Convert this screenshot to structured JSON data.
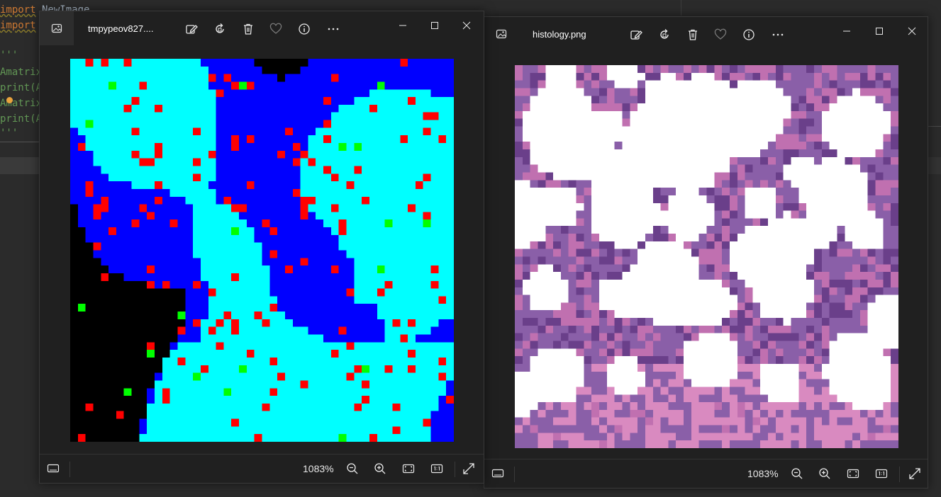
{
  "ide": {
    "lines": [
      {
        "kw": "import",
        "rest": " NewImage"
      },
      {
        "kw": "import",
        "rest": " "
      },
      {
        "kw": "",
        "rest": "'''"
      },
      {
        "kw": "",
        "rest": "Amatrix"
      },
      {
        "kw": "",
        "rest": "print(A"
      },
      {
        "kw": "",
        "rest": "Amatrix"
      },
      {
        "kw": "",
        "rest": "print(A"
      },
      {
        "kw": "",
        "rest": "'''"
      }
    ]
  },
  "windows": [
    {
      "title": "tmpypeov827....",
      "zoom": "1083%",
      "toolbar": [
        "edit-image",
        "rotate",
        "delete",
        "favorite",
        "file-info",
        "more"
      ],
      "image_kind": "label-map",
      "palette": [
        "#000000",
        "#0000ff",
        "#00ffff",
        "#ff0000",
        "#00ff00"
      ]
    },
    {
      "title": "histology.png",
      "zoom": "1083%",
      "toolbar": [
        "edit-image",
        "rotate",
        "delete",
        "favorite",
        "file-info",
        "more"
      ],
      "image_kind": "histology",
      "palette": [
        "#ffffff",
        "#8a5fa8",
        "#c070b0",
        "#6a3f8a",
        "#d98ac0"
      ]
    }
  ],
  "more_label": "···"
}
